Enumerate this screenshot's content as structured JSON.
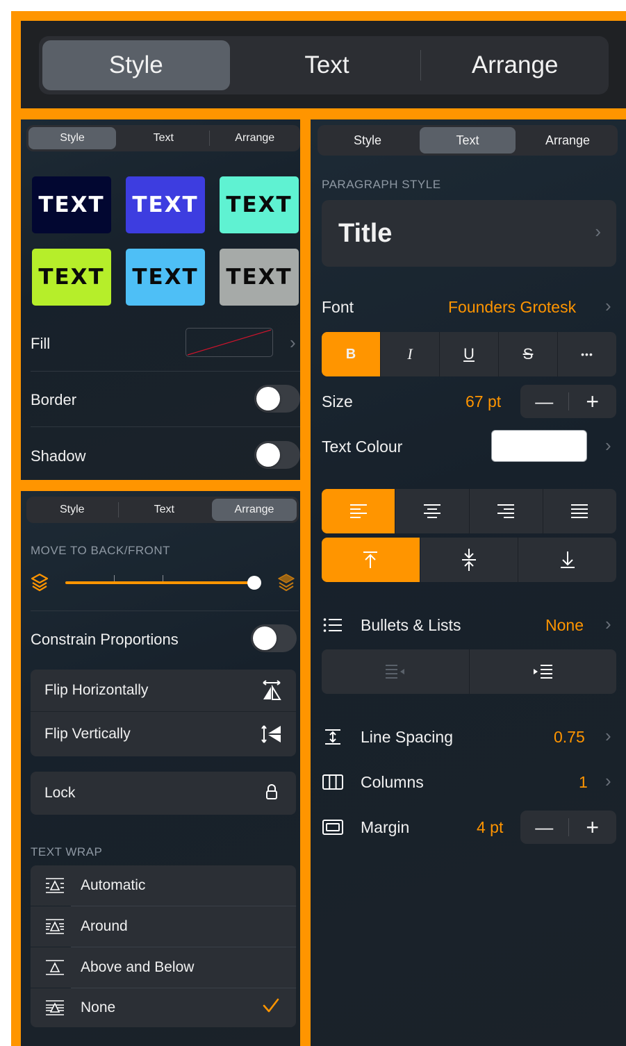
{
  "top_tabs": [
    "Style",
    "Text",
    "Arrange"
  ],
  "style_panel": {
    "tabs": [
      "Style",
      "Text",
      "Arrange"
    ],
    "tiles": [
      {
        "label": "TEXT",
        "bg": "#020731",
        "fg": "#ffffff"
      },
      {
        "label": "TEXT",
        "bg": "#3d3de0",
        "fg": "#ffffff"
      },
      {
        "label": "TEXT",
        "bg": "#5ff2d2",
        "fg": "#0a0a0a"
      },
      {
        "label": "TEXT",
        "bg": "#b6ee2a",
        "fg": "#0a0a0a"
      },
      {
        "label": "TEXT",
        "bg": "#4ebff6",
        "fg": "#0a0a0a"
      },
      {
        "label": "TEXT",
        "bg": "#a6aaa8",
        "fg": "#0a0a0a"
      }
    ],
    "fill_label": "Fill",
    "border_label": "Border",
    "shadow_label": "Shadow"
  },
  "arrange_panel": {
    "tabs": [
      "Style",
      "Text",
      "Arrange"
    ],
    "move_caption": "MOVE TO BACK/FRONT",
    "constrain_label": "Constrain Proportions",
    "flip_h": "Flip Horizontally",
    "flip_v": "Flip Vertically",
    "lock": "Lock",
    "wrap_caption": "TEXT WRAP",
    "wrap_options": [
      "Automatic",
      "Around",
      "Above and Below",
      "None"
    ],
    "wrap_selected": "None"
  },
  "text_panel": {
    "tabs": [
      "Style",
      "Text",
      "Arrange"
    ],
    "para_caption": "PARAGRAPH STYLE",
    "para_value": "Title",
    "font_label": "Font",
    "font_value": "Founders Grotesk",
    "format_buttons": [
      "B",
      "I",
      "U",
      "S",
      "•••"
    ],
    "size_label": "Size",
    "size_value": "67 pt",
    "text_colour_label": "Text Colour",
    "text_colour": "#ffffff",
    "bullets_label": "Bullets & Lists",
    "bullets_value": "None",
    "line_spacing_label": "Line Spacing",
    "line_spacing_value": "0.75",
    "columns_label": "Columns",
    "columns_value": "1",
    "margin_label": "Margin",
    "margin_value": "4 pt",
    "stepper_minus": "—",
    "stepper_plus": "+"
  },
  "colors": {
    "accent": "#ff9500",
    "panel": "#1e2730"
  }
}
